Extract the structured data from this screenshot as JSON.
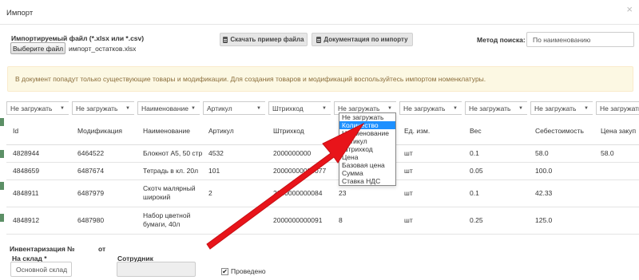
{
  "dialog": {
    "title": "Импорт",
    "close_label": "×"
  },
  "file": {
    "label": "Импортируемый файл (*.xlsx или *.csv)",
    "choose_button": "Выберите файл",
    "file_name": "импорт_остатков.xlsx"
  },
  "buttons": {
    "download_example": "Скачать пример файла",
    "import_docs": "Документация по импорту"
  },
  "search": {
    "label": "Метод поиска:",
    "value": "По наименованию"
  },
  "alert": {
    "text": "В документ попадут только существующие товары и модификации. Для создания товаров и модификаций воспользуйтесь импортом номенклатуры."
  },
  "column_selects": [
    "Не загружать",
    "Не загружать",
    "Наименование",
    "Артикул",
    "Штрихкод",
    "Не загружать",
    "Не загружать",
    "Не загружать",
    "Не загружать",
    "Не загружать"
  ],
  "table": {
    "headers": [
      "Id",
      "Модификация",
      "Наименование",
      "Артикул",
      "Штрихкод",
      "",
      "Ед. изм.",
      "Вес",
      "Себестоимость",
      "Цена закуп"
    ],
    "rows": [
      {
        "id": "4828944",
        "mod": "6464522",
        "name": "Блокнот А5, 50 стр",
        "sku": "4532",
        "barcode": "2000000000",
        "qty": "",
        "unit": "шт",
        "weight": "0.1",
        "cost": "58.0",
        "price": "58.0"
      },
      {
        "id": "4848659",
        "mod": "6487674",
        "name": "Тетрадь в кл. 20л",
        "sku": "101",
        "barcode": "20000000000077",
        "qty": "",
        "unit": "шт",
        "weight": "0.05",
        "cost": "100.0",
        "price": ""
      },
      {
        "id": "4848911",
        "mod": "6487979",
        "name_line1": "Скотч малярный",
        "name_line2": "широкий",
        "sku": "2",
        "barcode": "2000000000084",
        "qty": "23",
        "unit": "шт",
        "weight": "0.1",
        "cost": "42.33",
        "price": ""
      },
      {
        "id": "4848912",
        "mod": "6487980",
        "name_line1": "Набор цветной",
        "name_line2": "бумаги, 40л",
        "sku": "",
        "barcode": "2000000000091",
        "qty": "8",
        "unit": "шт",
        "weight": "0.25",
        "cost": "125.0",
        "price": ""
      }
    ]
  },
  "dropdown": {
    "selected": "Количество",
    "options": [
      "Не загружать",
      "Количество",
      "Наименование",
      "Артикул",
      "Штрихкод",
      "Цена",
      "Базовая цена",
      "Сумма",
      "Ставка НДС"
    ]
  },
  "inventory": {
    "label": "Инвентаризация №",
    "from_label": "от",
    "store_label": "На склад *",
    "store_value": "Основной склад",
    "employee_label": "Сотрудник",
    "posted_label": "Проведено",
    "posted_checked": "✔"
  },
  "colors": {
    "arrow": "#e8141a",
    "dropdown_highlight": "#1e90ff",
    "alert_bg": "#fcf8e3",
    "alert_text": "#8a6d3b"
  },
  "icons": [
    "close-icon",
    "document-icon",
    "dropdown-caret-icon",
    "checkbox-checked-icon",
    "red-arrow-annotation"
  ]
}
